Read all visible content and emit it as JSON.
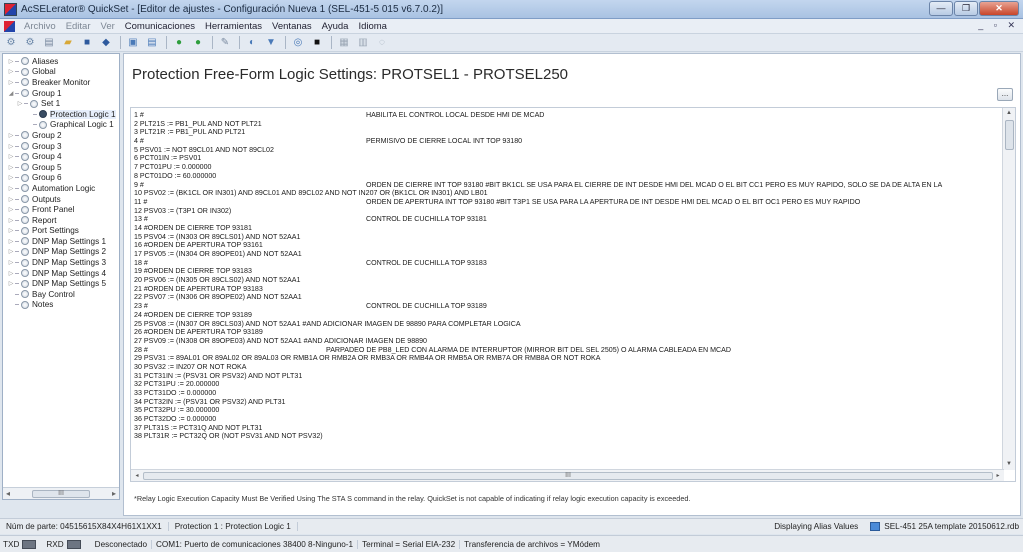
{
  "window": {
    "title": "AcSELerator® QuickSet - [Editor de ajustes - Configuración Nueva 1 (SEL-451-5 015 v6.7.0.2)]",
    "controls": [
      "—",
      "❐",
      "✕"
    ]
  },
  "menu": {
    "items": [
      {
        "label": "Archivo",
        "enabled": false
      },
      {
        "label": "Editar",
        "enabled": false
      },
      {
        "label": "Ver",
        "enabled": false
      },
      {
        "label": "Comunicaciones",
        "enabled": true
      },
      {
        "label": "Herramientas",
        "enabled": true
      },
      {
        "label": "Ventanas",
        "enabled": true
      },
      {
        "label": "Ayuda",
        "enabled": true
      },
      {
        "label": "Idioma",
        "enabled": true
      }
    ],
    "mdi_controls": "_ ▫ ✕"
  },
  "toolbar": {
    "buttons": [
      {
        "name": "new-settings-icon",
        "glyph": "⚙",
        "color": "#6a86a8"
      },
      {
        "name": "open-settings-icon",
        "glyph": "⚙",
        "color": "#6a86a8"
      },
      {
        "name": "read-icon",
        "glyph": "▤",
        "color": "#7a8aa0"
      },
      {
        "name": "open-folder-icon",
        "glyph": "▰",
        "color": "#d8a838"
      },
      {
        "name": "save-icon",
        "glyph": "■",
        "color": "#2e5a9e"
      },
      {
        "name": "send-icon",
        "glyph": "◆",
        "color": "#2e5a9e"
      },
      {
        "sep": true
      },
      {
        "name": "terminal-icon",
        "glyph": "▣",
        "color": "#4a7ab8"
      },
      {
        "name": "report-icon",
        "glyph": "▤",
        "color": "#4a7ab8"
      },
      {
        "sep": true
      },
      {
        "name": "connect-icon",
        "glyph": "●",
        "color": "#2e9e3e"
      },
      {
        "name": "disconnect-icon",
        "glyph": "●",
        "color": "#2e9e3e"
      },
      {
        "sep": true
      },
      {
        "name": "tools-icon",
        "glyph": "✎",
        "color": "#7a8aa0"
      },
      {
        "sep": true
      },
      {
        "name": "meter-icon",
        "glyph": "◐",
        "color": "#4a7ab8"
      },
      {
        "name": "events-icon",
        "glyph": "▼",
        "color": "#4a7ab8"
      },
      {
        "sep": true
      },
      {
        "name": "hmi-icon",
        "glyph": "◎",
        "color": "#4a7ab8"
      },
      {
        "name": "black-square-icon",
        "glyph": "■",
        "color": "#111"
      },
      {
        "sep": true
      },
      {
        "name": "grid-icon",
        "glyph": "▦",
        "color": "#9aa6b4"
      },
      {
        "name": "list-icon",
        "glyph": "▥",
        "color": "#9aa6b4"
      },
      {
        "name": "help-icon",
        "glyph": "◌",
        "color": "#9aa6b4"
      }
    ]
  },
  "tree": {
    "items": [
      {
        "label": "Aliases",
        "level": 0,
        "arrow": "▷",
        "filled": false
      },
      {
        "label": "Global",
        "level": 0,
        "arrow": "▷",
        "filled": false
      },
      {
        "label": "Breaker Monitor",
        "level": 0,
        "arrow": "▷",
        "filled": false
      },
      {
        "label": "Group 1",
        "level": 0,
        "arrow": "◢",
        "filled": false
      },
      {
        "label": "Set 1",
        "level": 1,
        "arrow": "▷",
        "filled": false
      },
      {
        "label": "Protection Logic 1",
        "level": 2,
        "arrow": "",
        "filled": true,
        "selected": true
      },
      {
        "label": "Graphical Logic 1",
        "level": 2,
        "arrow": "",
        "filled": false
      },
      {
        "label": "Group 2",
        "level": 0,
        "arrow": "▷",
        "filled": false
      },
      {
        "label": "Group 3",
        "level": 0,
        "arrow": "▷",
        "filled": false
      },
      {
        "label": "Group 4",
        "level": 0,
        "arrow": "▷",
        "filled": false
      },
      {
        "label": "Group 5",
        "level": 0,
        "arrow": "▷",
        "filled": false
      },
      {
        "label": "Group 6",
        "level": 0,
        "arrow": "▷",
        "filled": false
      },
      {
        "label": "Automation Logic",
        "level": 0,
        "arrow": "▷",
        "filled": false
      },
      {
        "label": "Outputs",
        "level": 0,
        "arrow": "▷",
        "filled": false
      },
      {
        "label": "Front Panel",
        "level": 0,
        "arrow": "▷",
        "filled": false
      },
      {
        "label": "Report",
        "level": 0,
        "arrow": "▷",
        "filled": false
      },
      {
        "label": "Port Settings",
        "level": 0,
        "arrow": "▷",
        "filled": false
      },
      {
        "label": "DNP Map Settings 1",
        "level": 0,
        "arrow": "▷",
        "filled": false
      },
      {
        "label": "DNP Map Settings 2",
        "level": 0,
        "arrow": "▷",
        "filled": false
      },
      {
        "label": "DNP Map Settings 3",
        "level": 0,
        "arrow": "▷",
        "filled": false
      },
      {
        "label": "DNP Map Settings 4",
        "level": 0,
        "arrow": "▷",
        "filled": false
      },
      {
        "label": "DNP Map Settings 5",
        "level": 0,
        "arrow": "▷",
        "filled": false
      },
      {
        "label": "Bay Control",
        "level": 0,
        "arrow": "",
        "filled": false
      },
      {
        "label": "Notes",
        "level": 0,
        "arrow": "",
        "filled": false
      }
    ],
    "hscroll_thumb": "III"
  },
  "main": {
    "title": "Protection Free-Form Logic Settings: PROTSEL1 - PROTSEL250",
    "ellipsis_label": "...",
    "lines": [
      {
        "code": "1 #",
        "comment": "HABILITA EL CONTROL LOCAL DESDE HMI DE MCAD",
        "col": 1
      },
      {
        "code": "2 PLT21S := PB1_PUL AND NOT PLT21",
        "comment": "",
        "col": 0
      },
      {
        "code": "3 PLT21R := PB1_PUL AND PLT21",
        "comment": "",
        "col": 0
      },
      {
        "code": "4 #",
        "comment": "PERMISIVO DE CIERRE LOCAL INT TOP 93180",
        "col": 1
      },
      {
        "code": "5 PSV01 := NOT 89CL01 AND NOT 89CL02",
        "comment": "",
        "col": 0
      },
      {
        "code": "6 PCT01IN := PSV01",
        "comment": "",
        "col": 0
      },
      {
        "code": "7 PCT01PU := 0.000000",
        "comment": "",
        "col": 0
      },
      {
        "code": "8 PCT01DO := 60.000000",
        "comment": "",
        "col": 0
      },
      {
        "code": "9 #",
        "comment": "ORDEN DE CIERRE INT TOP 93180 #BIT BK1CL SE USA PARA EL CIERRE DE INT DESDE HMI DEL MCAD O EL BIT CC1 PERO ES MUY RAPIDO, SOLO SE DA DE ALTA EN LA",
        "col": 2
      },
      {
        "code": "10 PSV02 := (BK1CL OR IN301) AND 89CL01 AND 89CL02 AND NOT IN207 OR (BK1CL OR IN301) AND LB01",
        "comment": "",
        "col": 0
      },
      {
        "code": "11 #",
        "comment": "ORDEN DE APERTURA  INT TOP 93180 #BIT T3P1 SE USA PARA LA APERTURA DE INT DESDE HMI DEL MCAD O EL BIT OC1 PERO ES MUY RAPIDO",
        "col": 2
      },
      {
        "code": "12 PSV03 := (T3P1 OR IN302)",
        "comment": "",
        "col": 0
      },
      {
        "code": "13 #",
        "comment": "CONTROL DE CUCHILLA TOP 93181",
        "col": 1
      },
      {
        "code": "14 #ORDEN DE CIERRE TOP 93181",
        "comment": "",
        "col": 0
      },
      {
        "code": "15 PSV04 := (IN303 OR 89CLS01) AND NOT 52AA1",
        "comment": "",
        "col": 0
      },
      {
        "code": "16 #ORDEN DE APERTURA TOP 93161",
        "comment": "",
        "col": 0
      },
      {
        "code": "17 PSV05 := (IN304 OR 89OPE01) AND NOT 52AA1",
        "comment": "",
        "col": 0
      },
      {
        "code": "18 #",
        "comment": "CONTROL DE CUCHILLA TOP 93183",
        "col": 1
      },
      {
        "code": "19 #ORDEN DE CIERRE TOP 93183",
        "comment": "",
        "col": 0
      },
      {
        "code": "20 PSV06 := (IN305 OR 89CLS02) AND NOT 52AA1",
        "comment": "",
        "col": 0
      },
      {
        "code": "21 #ORDEN DE APERTURA TOP 93183",
        "comment": "",
        "col": 0
      },
      {
        "code": "22 PSV07 := (IN306 OR 89OPE02) AND NOT 52AA1",
        "comment": "",
        "col": 0
      },
      {
        "code": "23 #",
        "comment": "CONTROL DE CUCHILLA TOP 93189",
        "col": 1
      },
      {
        "code": "24 #ORDEN DE CIERRE TOP 93189",
        "comment": "",
        "col": 0
      },
      {
        "code": "25 PSV08 := (IN307 OR 89CLS03) AND NOT 52AA1 #AND ADICIONAR IMAGEN DE 98890 PARA COMPLETAR LOGICA",
        "comment": "",
        "col": 0
      },
      {
        "code": "26 #ORDEN DE APERTURA TOP 93189",
        "comment": "",
        "col": 0
      },
      {
        "code": "27 PSV09 := (IN308 OR 89OPE03) AND NOT 52AA1 #AND ADICIONAR IMAGEN DE 98890",
        "comment": "",
        "col": 0
      },
      {
        "code": "28 #",
        "comment": "PARPADEO DE PB8_LED CON ALARMA DE INTERRUPTOR (MIRROR BIT DEL SEL 2505) O ALARMA CABLEADA EN MCAD",
        "col": 3
      },
      {
        "code": "29 PSV31 := 89AL01 OR 89AL02 OR 89AL03 OR RMB1A OR RMB2A OR RMB3A OR RMB4A OR RMB5A OR RMB7A OR RMB8A OR NOT ROKA",
        "comment": "",
        "col": 0
      },
      {
        "code": "30 PSV32 := IN207 OR NOT ROKA",
        "comment": "",
        "col": 0
      },
      {
        "code": "31 PCT31IN := (PSV31 OR PSV32) AND NOT PLT31",
        "comment": "",
        "col": 0
      },
      {
        "code": "32 PCT31PU := 20.000000",
        "comment": "",
        "col": 0
      },
      {
        "code": "33 PCT31DO := 0.000000",
        "comment": "",
        "col": 0
      },
      {
        "code": "34 PCT32IN := (PSV31 OR PSV32) AND PLT31",
        "comment": "",
        "col": 0
      },
      {
        "code": "35 PCT32PU := 30.000000",
        "comment": "",
        "col": 0
      },
      {
        "code": "36 PCT32DO := 0.000000",
        "comment": "",
        "col": 0
      },
      {
        "code": "37 PLT31S := PCT31Q AND NOT PLT31",
        "comment": "",
        "col": 0
      },
      {
        "code": "38 PLT31R := PCT32Q OR (NOT PSV31 AND NOT PSV32)",
        "comment": "",
        "col": 0
      }
    ],
    "hscroll_thumb": "III",
    "footnote": "*Relay Logic Execution Capacity Must Be Verified Using The STA S command in the relay. QuickSet is not capable of indicating if relay logic execution capacity is exceeded."
  },
  "status": {
    "part_number": "Núm de parte: 04515615X84X4H61X1XX1",
    "current_view": "Protection 1 : Protection Logic 1",
    "alias_mode": "Displaying Alias Values",
    "template": "SEL-451 25A template 20150612.rdb",
    "txd": "TXD",
    "rxd": "RXD",
    "connection": "Desconectado",
    "port": "COM1: Puerto de comunicaciones  38400  8-Ninguno-1",
    "terminal": "Terminal = Serial EIA-232",
    "transfer": "Transferencia de archivos = YMódem"
  }
}
